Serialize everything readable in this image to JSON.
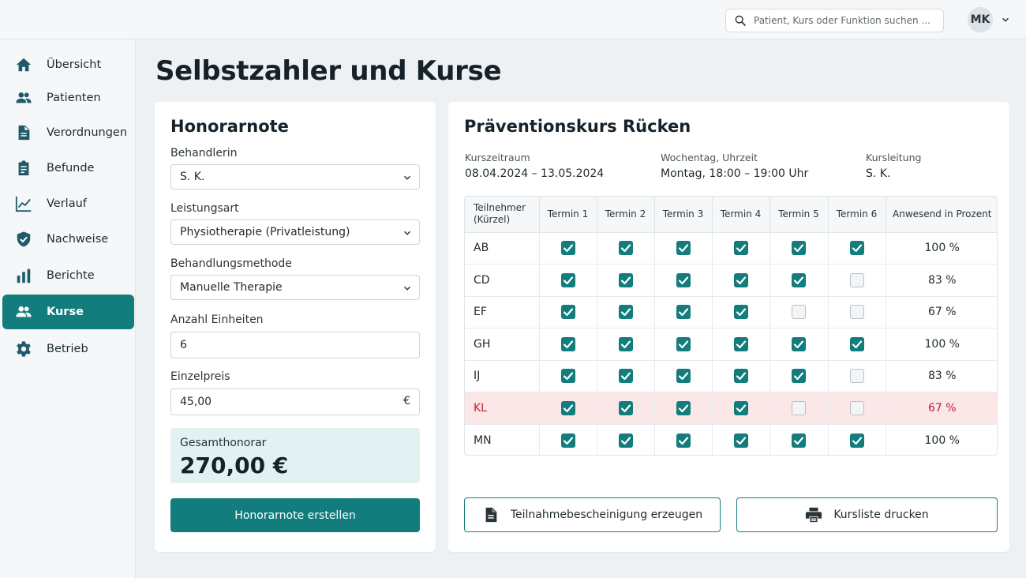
{
  "header": {
    "search_placeholder": "Patient, Kurs oder Funktion suchen ...",
    "user_initials": "MK"
  },
  "sidebar": {
    "items": [
      {
        "label": "Übersicht",
        "icon": "home-icon"
      },
      {
        "label": "Patienten",
        "icon": "people-icon"
      },
      {
        "label": "Verordnungen",
        "icon": "document-icon"
      },
      {
        "label": "Befunde",
        "icon": "clipboard-icon"
      },
      {
        "label": "Verlauf",
        "icon": "chart-line-icon"
      },
      {
        "label": "Nachweise",
        "icon": "shield-check-icon"
      },
      {
        "label": "Berichte",
        "icon": "bar-chart-icon"
      },
      {
        "label": "Kurse",
        "icon": "people-icon",
        "active": true
      },
      {
        "label": "Betrieb",
        "icon": "gear-icon"
      }
    ]
  },
  "page": {
    "title": "Selbstzahler und Kurse"
  },
  "invoice": {
    "title": "Honorarnote",
    "therapist_label": "Behandlerin",
    "therapist_value": "S. K.",
    "service_label": "Leistungsart",
    "service_value": "Physiotherapie (Privatleistung)",
    "method_label": "Behandlungsmethode",
    "method_value": "Manuelle Therapie",
    "units_label": "Anzahl Einheiten",
    "units_value": "6",
    "price_label": "Einzelpreis",
    "price_value": "45,00",
    "currency": "€",
    "total_label": "Gesamthonorar",
    "total_value": "270,00 €",
    "create_button": "Honorarnote erstellen"
  },
  "course": {
    "title": "Präventionskurs Rücken",
    "period_label": "Kurszeitraum",
    "period_value": "08.04.2024 – 13.05.2024",
    "weekday_label": "Wochentag, Uhrzeit",
    "weekday_value": "Montag, 18:00 – 19:00 Uhr",
    "lead_label": "Kursleitung",
    "lead_value": "S. K.",
    "table": {
      "headers": [
        "Teilnehmer (Kürzel)",
        "Termin 1",
        "Termin 2",
        "Termin 3",
        "Termin 4",
        "Termin 5",
        "Termin 6",
        "Anwesend in Prozent"
      ],
      "rows": [
        {
          "id": "AB",
          "attendance": [
            true,
            true,
            true,
            true,
            true,
            true
          ],
          "percent": "100 %"
        },
        {
          "id": "CD",
          "attendance": [
            true,
            true,
            true,
            true,
            true,
            false
          ],
          "percent": "83 %"
        },
        {
          "id": "EF",
          "attendance": [
            true,
            true,
            true,
            true,
            false,
            false
          ],
          "percent": "67 %"
        },
        {
          "id": "GH",
          "attendance": [
            true,
            true,
            true,
            true,
            true,
            true
          ],
          "percent": "100 %"
        },
        {
          "id": "IJ",
          "attendance": [
            true,
            true,
            true,
            true,
            true,
            false
          ],
          "percent": "83 %"
        },
        {
          "id": "KL",
          "attendance": [
            true,
            true,
            true,
            true,
            false,
            false
          ],
          "percent": "67 %",
          "highlight": true
        },
        {
          "id": "MN",
          "attendance": [
            true,
            true,
            true,
            true,
            true,
            true
          ],
          "percent": "100 %"
        }
      ]
    },
    "certificate_button": "Teilnahmebescheinigung erzeugen",
    "print_button": "Kursliste drucken"
  },
  "colors": {
    "accent": "#137c7c",
    "warning_row_bg": "#fbe7e8",
    "warning_text": "#c21f32"
  }
}
